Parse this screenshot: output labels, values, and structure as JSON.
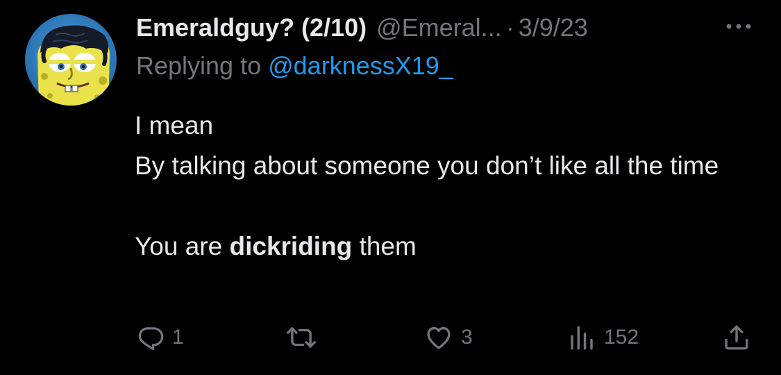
{
  "tweet": {
    "display_name": "Emeraldguy? (2/10)",
    "handle": "@Emeral...",
    "separator": "·",
    "date": "3/9/23",
    "replying_prefix": "Replying to ",
    "replying_to": "@darknessX19_",
    "body": {
      "line1": "I mean",
      "line2": "By talking about someone you don’t like all the time",
      "line3_before": "You are ",
      "line3_bold": "dickriding",
      "line3_after": " them"
    }
  },
  "actions": {
    "replies": "1",
    "retweets": "",
    "likes": "3",
    "views": "152"
  },
  "icons": {
    "more": "more-icon",
    "reply": "reply-icon",
    "retweet": "retweet-icon",
    "like": "heart-icon",
    "views": "views-icon",
    "share": "share-icon"
  },
  "colors": {
    "background": "#000000",
    "text": "#e7e9ea",
    "muted": "#71767b",
    "link": "#1d9bf0"
  }
}
